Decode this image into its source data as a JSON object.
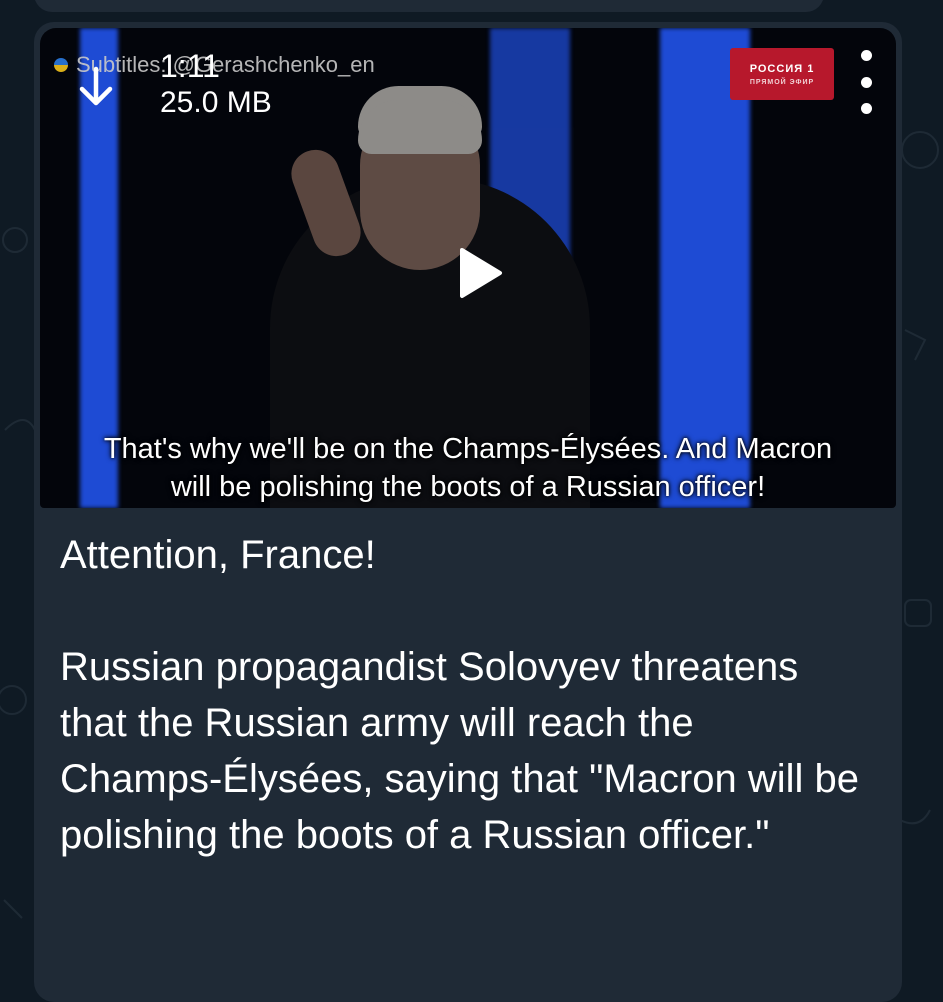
{
  "video": {
    "duration": "1:11",
    "file_size": "25.0 MB",
    "watermark_text": "Subtitles: @Gerashchenko_en",
    "channel_logo_text": "РОССИЯ 1",
    "channel_logo_sub": "ПРЯМОЙ ЭФИР",
    "subtitle_line1": "That's why we'll be on the Champs-Élysées. And Macron",
    "subtitle_line2": "will be polishing the boots of a Russian officer!",
    "icons": {
      "download": "download-arrow-icon",
      "play": "play-icon",
      "menu": "more-vertical-icon"
    }
  },
  "message": {
    "caption": "Attention, France!\n\nRussian propagandist Solovyev threatens that the Russian army will reach the Champs-Élysées, saying that \"Macron will be polishing the boots of a Russian officer.\""
  },
  "colors": {
    "background": "#0f1a24",
    "bubble": "#1f2a36",
    "text": "#ffffff",
    "stage_blue": "#1e4bd4"
  }
}
